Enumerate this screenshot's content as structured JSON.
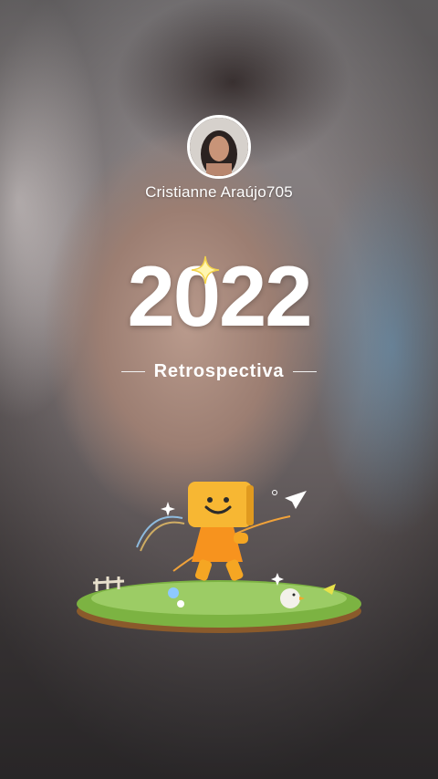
{
  "profile": {
    "username": "Cristianne Araújo705",
    "avatar_icon": "profile-photo"
  },
  "title": {
    "year": "2022",
    "subtitle": "Retrospectiva"
  },
  "illustration": {
    "name": "box-character-walking-on-grass-island"
  },
  "colors": {
    "text": "#ffffff",
    "character": "#f7a829",
    "grass": "#7cb342"
  }
}
